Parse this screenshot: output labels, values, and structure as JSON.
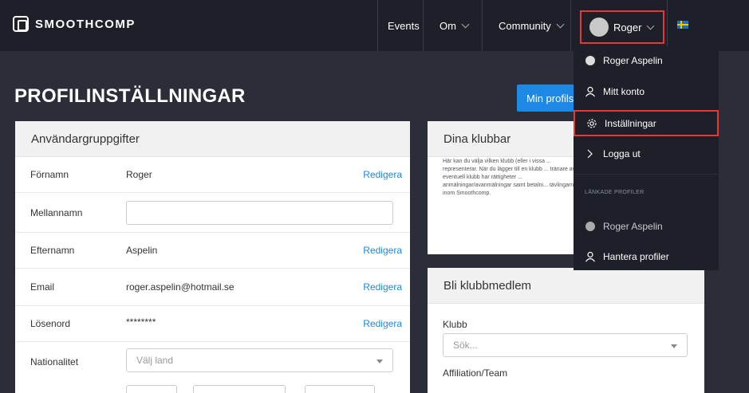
{
  "brand": "SMOOTHCOMP",
  "nav": {
    "events": "Events",
    "about": "Om",
    "community": "Community",
    "user": "Roger"
  },
  "page": {
    "title": "PROFILINSTÄLLNINGAR",
    "profile_button": "Min profilsi"
  },
  "user_card": {
    "title": "Användargruppgifter",
    "rows": [
      {
        "label": "Förnamn",
        "value": "Roger",
        "action": "Redigera"
      },
      {
        "label": "Mellannamn",
        "value": "",
        "action": ""
      },
      {
        "label": "Efternamn",
        "value": "Aspelin",
        "action": "Redigera"
      },
      {
        "label": "Email",
        "value": "roger.aspelin@hotmail.se",
        "action": "Redigera"
      },
      {
        "label": "Lösenord",
        "value": "********",
        "action": "Redigera"
      },
      {
        "label": "Nationalitet",
        "value": "",
        "action": ""
      }
    ],
    "nationality_placeholder": "Välj land"
  },
  "clubs_card": {
    "title": "Dina klubbar",
    "description": "Här kan du välja vilken klubb (eller i vissa ... representerar. När du lägger till en klubb ... tränare av eventuell klubb har rättigheter ... anmälningar/avanmälningar samt betalni... tävlingarna inom Smoothcomp."
  },
  "member_card": {
    "title": "Bli klubbmedlem",
    "club_label": "Klubb",
    "club_placeholder": "Sök...",
    "affiliation_label": "Affiliation/Team"
  },
  "dropdown": {
    "profile_name": "Roger Aspelin",
    "account": "Mitt konto",
    "settings": "Inställningar",
    "logout": "Logga ut",
    "linked_section": "LÄNKADE PROFILER",
    "linked_profile": "Roger Aspelin",
    "manage_profiles": "Hantera profiler"
  },
  "colors": {
    "accent": "#1e88e5",
    "highlight": "#e53935",
    "background": "#2b2e38",
    "topbar": "#1e2029"
  }
}
